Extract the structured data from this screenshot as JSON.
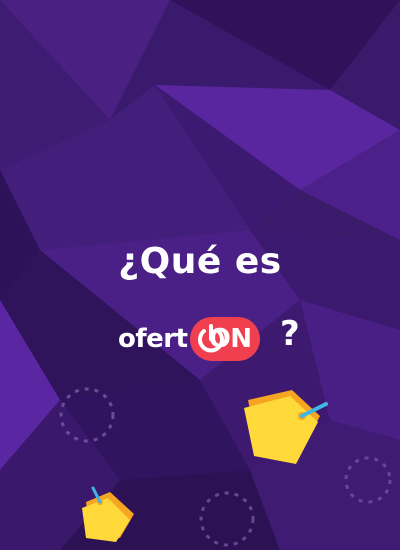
{
  "headline": "¿Qué es",
  "brand": {
    "prefix": "ofert",
    "highlight": "ON",
    "accent_color": "#f0404f"
  },
  "question_mark": "?",
  "colors": {
    "background": "#3b1a6e",
    "text": "#ffffff",
    "tag_yellow": "#ffd83a",
    "tag_orange": "#f5a522",
    "tag_string": "#3fb7e6"
  },
  "icons": [
    "power-icon",
    "price-tag-icon",
    "dashed-circle-icon"
  ]
}
